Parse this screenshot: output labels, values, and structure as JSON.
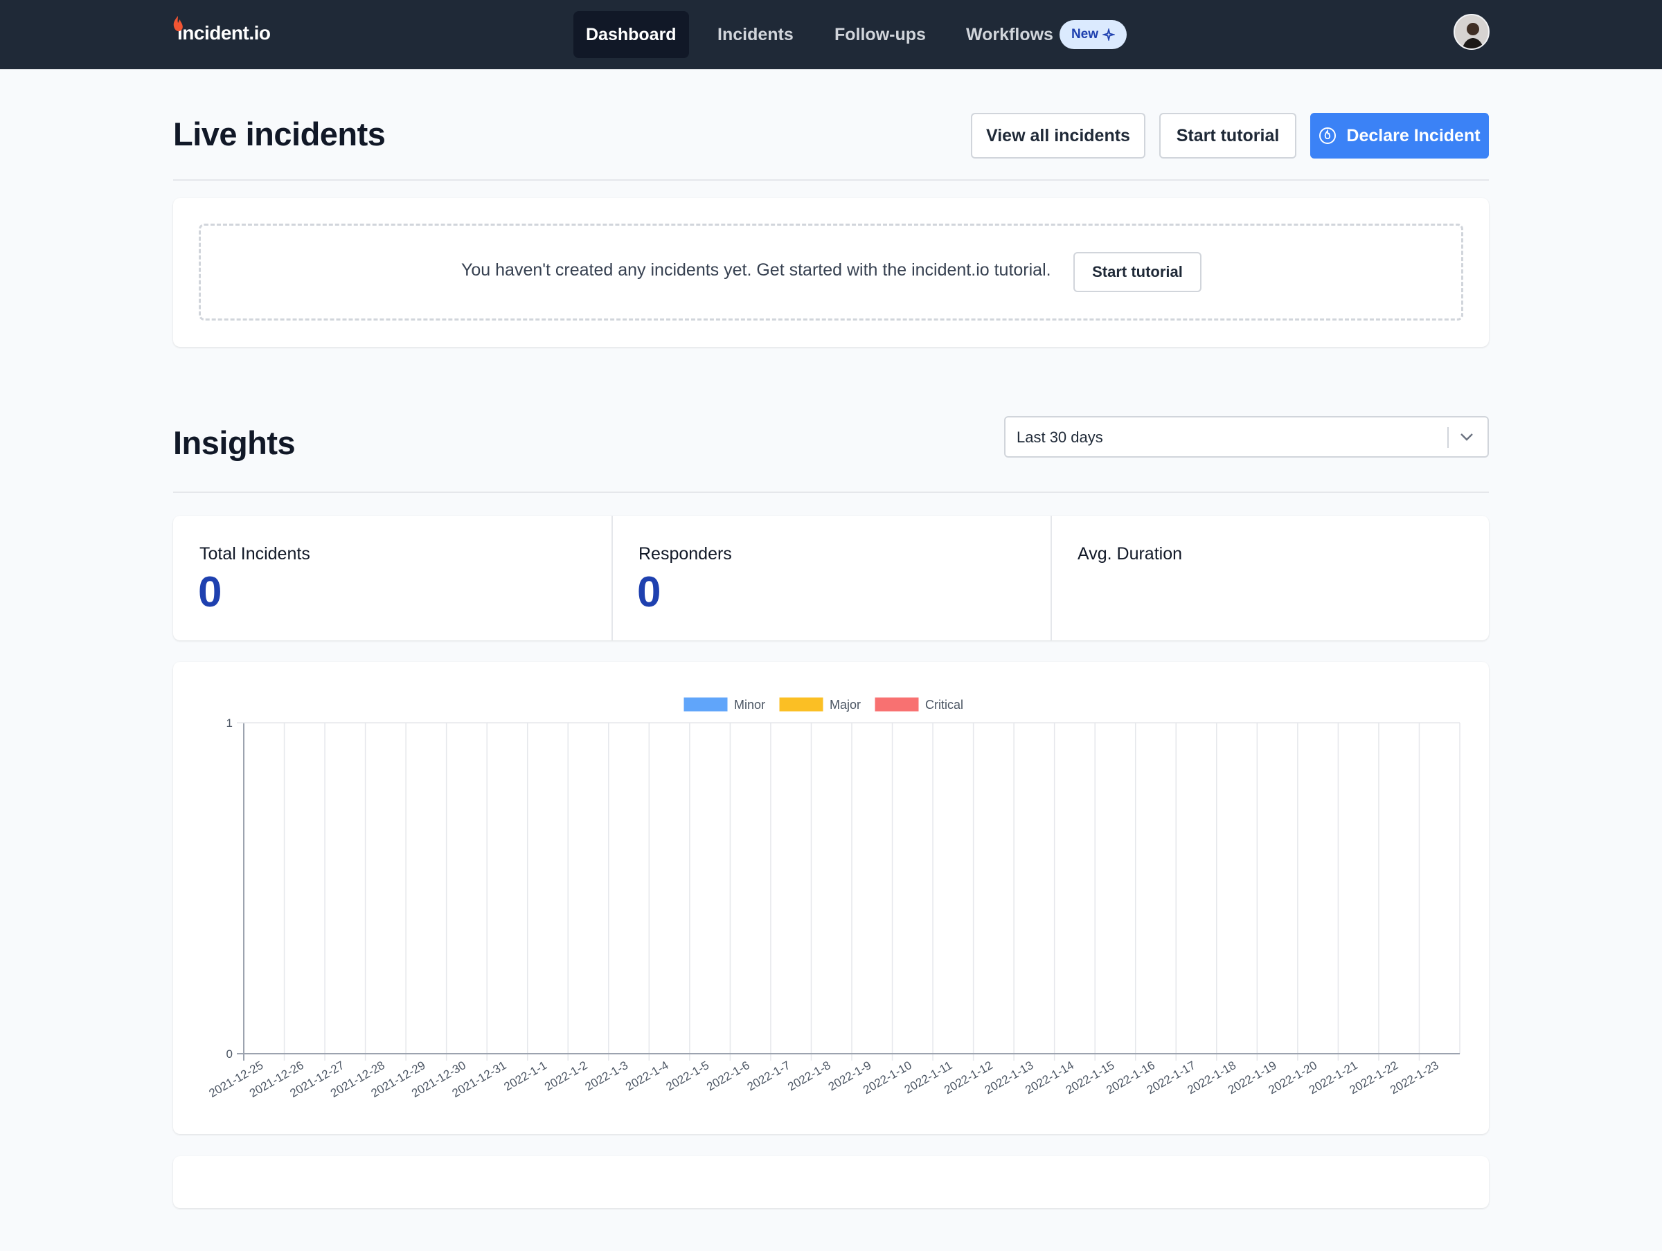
{
  "nav": {
    "logo_text": "incident.io",
    "items": [
      {
        "label": "Dashboard",
        "active": true
      },
      {
        "label": "Incidents",
        "active": false
      },
      {
        "label": "Follow-ups",
        "active": false
      },
      {
        "label": "Workflows",
        "active": false
      }
    ],
    "badge": "New",
    "badge_icon": "sparkle-icon",
    "avatar_icon": "user-avatar"
  },
  "live": {
    "title": "Live incidents",
    "view_all_label": "View all incidents",
    "start_tutorial_label": "Start tutorial",
    "declare_label": "Declare Incident",
    "declare_icon": "flame-icon",
    "empty_text": "You haven't created any incidents yet. Get started with the incident.io tutorial.",
    "empty_button": "Start tutorial"
  },
  "insights": {
    "title": "Insights",
    "range_value": "Last 30 days",
    "range_icon": "chevron-down-icon",
    "stats": [
      {
        "label": "Total Incidents",
        "value": "0"
      },
      {
        "label": "Responders",
        "value": "0"
      },
      {
        "label": "Avg. Duration",
        "value": ""
      }
    ]
  },
  "colors": {
    "nav_bg": "#1f2937",
    "accent": "#3b82f6",
    "stat_value": "#1e40af",
    "minor": "#60a5fa",
    "major": "#fbbf24",
    "critical": "#f87171"
  },
  "chart_data": {
    "type": "bar",
    "legend_position": "top-center",
    "grid": true,
    "ylim": [
      0,
      1
    ],
    "yticks": [
      "0",
      "1"
    ],
    "categories": [
      "2021-12-25",
      "2021-12-26",
      "2021-12-27",
      "2021-12-28",
      "2021-12-29",
      "2021-12-30",
      "2021-12-31",
      "2022-1-1",
      "2022-1-2",
      "2022-1-3",
      "2022-1-4",
      "2022-1-5",
      "2022-1-6",
      "2022-1-7",
      "2022-1-8",
      "2022-1-9",
      "2022-1-10",
      "2022-1-11",
      "2022-1-12",
      "2022-1-13",
      "2022-1-14",
      "2022-1-15",
      "2022-1-16",
      "2022-1-17",
      "2022-1-18",
      "2022-1-19",
      "2022-1-20",
      "2022-1-21",
      "2022-1-22",
      "2022-1-23"
    ],
    "series": [
      {
        "name": "Minor",
        "color": "#60a5fa",
        "values": [
          0,
          0,
          0,
          0,
          0,
          0,
          0,
          0,
          0,
          0,
          0,
          0,
          0,
          0,
          0,
          0,
          0,
          0,
          0,
          0,
          0,
          0,
          0,
          0,
          0,
          0,
          0,
          0,
          0,
          0
        ]
      },
      {
        "name": "Major",
        "color": "#fbbf24",
        "values": [
          0,
          0,
          0,
          0,
          0,
          0,
          0,
          0,
          0,
          0,
          0,
          0,
          0,
          0,
          0,
          0,
          0,
          0,
          0,
          0,
          0,
          0,
          0,
          0,
          0,
          0,
          0,
          0,
          0,
          0
        ]
      },
      {
        "name": "Critical",
        "color": "#f87171",
        "values": [
          0,
          0,
          0,
          0,
          0,
          0,
          0,
          0,
          0,
          0,
          0,
          0,
          0,
          0,
          0,
          0,
          0,
          0,
          0,
          0,
          0,
          0,
          0,
          0,
          0,
          0,
          0,
          0,
          0,
          0
        ]
      }
    ]
  }
}
